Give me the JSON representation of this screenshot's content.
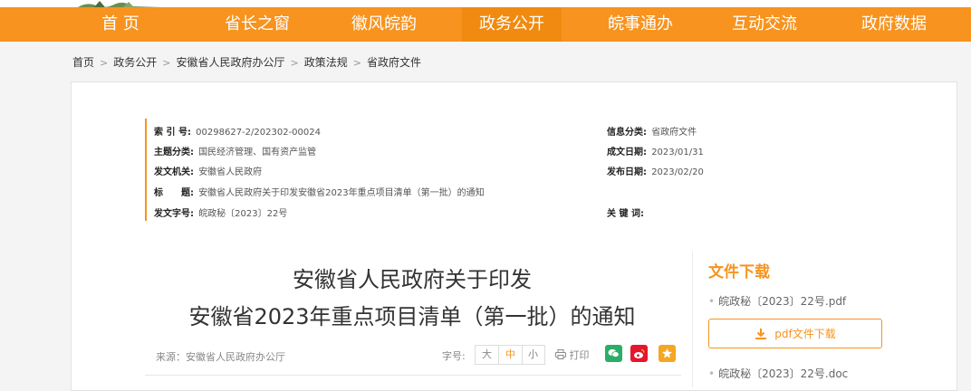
{
  "nav": {
    "items": [
      "首 页",
      "省长之窗",
      "徽风皖韵",
      "政务公开",
      "皖事通办",
      "互动交流",
      "政府数据"
    ],
    "active_index": 3
  },
  "breadcrumb": [
    "首页",
    "政务公开",
    "安徽省人民政府办公厅",
    "政策法规",
    "省政府文件"
  ],
  "meta": {
    "index_label": "索 引 号:",
    "index_value": "00298627-2/202302-00024",
    "category_label": "信息分类:",
    "category_value": "省政府文件",
    "topic_label": "主题分类:",
    "topic_value": "国民经济管理、国有资产监管",
    "created_label": "成文日期:",
    "created_value": "2023/01/31",
    "issuer_label": "发文机关:",
    "issuer_value": "安徽省人民政府",
    "published_label": "发布日期:",
    "published_value": "2023/02/20",
    "title_label": "标　　题:",
    "title_value": "安徽省人民政府关于印发安徽省2023年重点项目清单（第一批）的通知",
    "docno_label": "发文字号:",
    "docno_value": "皖政秘〔2023〕22号",
    "keywords_label": "关 键 词:",
    "keywords_value": ""
  },
  "article": {
    "title_line1": "安徽省人民政府关于印发",
    "title_line2": "安徽省2023年重点项目清单（第一批）的通知",
    "source": "来源：安徽省人民政府办公厅"
  },
  "tools": {
    "font_size_label": "字号:",
    "sizes": [
      "大",
      "中",
      "小"
    ],
    "print_label": "打印"
  },
  "download": {
    "title": "文件下载",
    "pdf_name": "皖政秘〔2023〕22号.pdf",
    "pdf_button": "pdf文件下载",
    "doc_name": "皖政秘〔2023〕22号.doc"
  },
  "colors": {
    "accent": "#f7931e",
    "wechat": "#2aae67",
    "weibo": "#e6162d",
    "favorite": "#f5a623"
  }
}
